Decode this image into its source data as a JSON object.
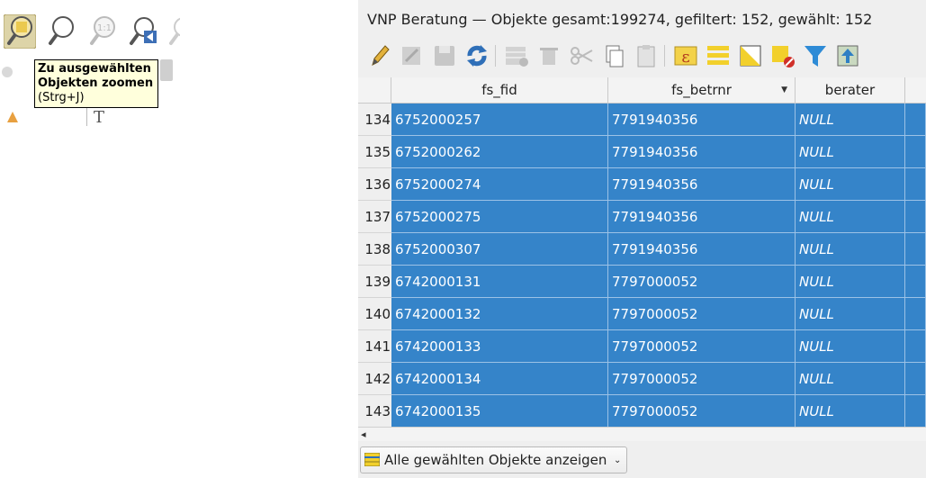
{
  "tooltip": {
    "title": "Zu ausgewählten Objekten zoomen",
    "shortcut": "(Strg+J)"
  },
  "window": {
    "title": "VNP Beratung — Objekte gesamt:199274, gefiltert: 152, gewählt: 152"
  },
  "toolbar": {
    "icons": [
      "pencil-icon",
      "toggle-edit-icon",
      "save-edits-icon",
      "reload-icon",
      "add-feature-icon",
      "delete-feature-icon",
      "cut-icon",
      "copy-icon",
      "paste-icon",
      "expression-select-icon",
      "select-all-icon",
      "invert-selection-icon",
      "deselect-icon",
      "filter-icon",
      "move-to-top-icon"
    ]
  },
  "table": {
    "columns": [
      "fs_fid",
      "fs_betrnr",
      "berater"
    ],
    "rows": [
      {
        "n": "134",
        "fs_fid": "6752000257",
        "fs_betrnr": "7791940356",
        "berater": "NULL"
      },
      {
        "n": "135",
        "fs_fid": "6752000262",
        "fs_betrnr": "7791940356",
        "berater": "NULL"
      },
      {
        "n": "136",
        "fs_fid": "6752000274",
        "fs_betrnr": "7791940356",
        "berater": "NULL"
      },
      {
        "n": "137",
        "fs_fid": "6752000275",
        "fs_betrnr": "7791940356",
        "berater": "NULL"
      },
      {
        "n": "138",
        "fs_fid": "6752000307",
        "fs_betrnr": "7791940356",
        "berater": "NULL"
      },
      {
        "n": "139",
        "fs_fid": "6742000131",
        "fs_betrnr": "7797000052",
        "berater": "NULL"
      },
      {
        "n": "140",
        "fs_fid": "6742000132",
        "fs_betrnr": "7797000052",
        "berater": "NULL"
      },
      {
        "n": "141",
        "fs_fid": "6742000133",
        "fs_betrnr": "7797000052",
        "berater": "NULL"
      },
      {
        "n": "142",
        "fs_fid": "6742000134",
        "fs_betrnr": "7797000052",
        "berater": "NULL"
      },
      {
        "n": "143",
        "fs_fid": "6742000135",
        "fs_betrnr": "7797000052",
        "berater": "NULL"
      }
    ]
  },
  "bottom": {
    "filter_label": "Alle gewählten Objekte anzeigen"
  },
  "colors": {
    "selection": "#3584c9",
    "tooltip_bg": "#ffffdc"
  }
}
